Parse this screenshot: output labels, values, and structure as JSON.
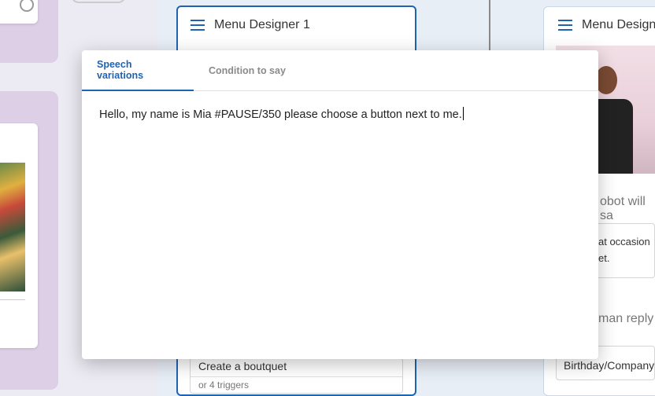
{
  "background": {
    "designer_left_title": "Menu Designer 1",
    "designer_right_title": "Menu Design",
    "right_robot_text": "obot will sa",
    "right_occasion_text": "at occasion\net.",
    "right_human_reply": "man reply",
    "right_reply_value": "Birthday/Company",
    "bottom_item_title": "Create a boutquet",
    "bottom_item_sub": "or 4 triggers"
  },
  "modal": {
    "tabs": [
      {
        "label": "Speech variations",
        "active": true
      },
      {
        "label": "Condition to say",
        "active": false
      }
    ],
    "speech_text": "Hello, my name is Mia #PAUSE/350 please choose a button next to me."
  },
  "colors": {
    "accent": "#1f63b3",
    "tab_inactive": "#8a8a8a"
  }
}
